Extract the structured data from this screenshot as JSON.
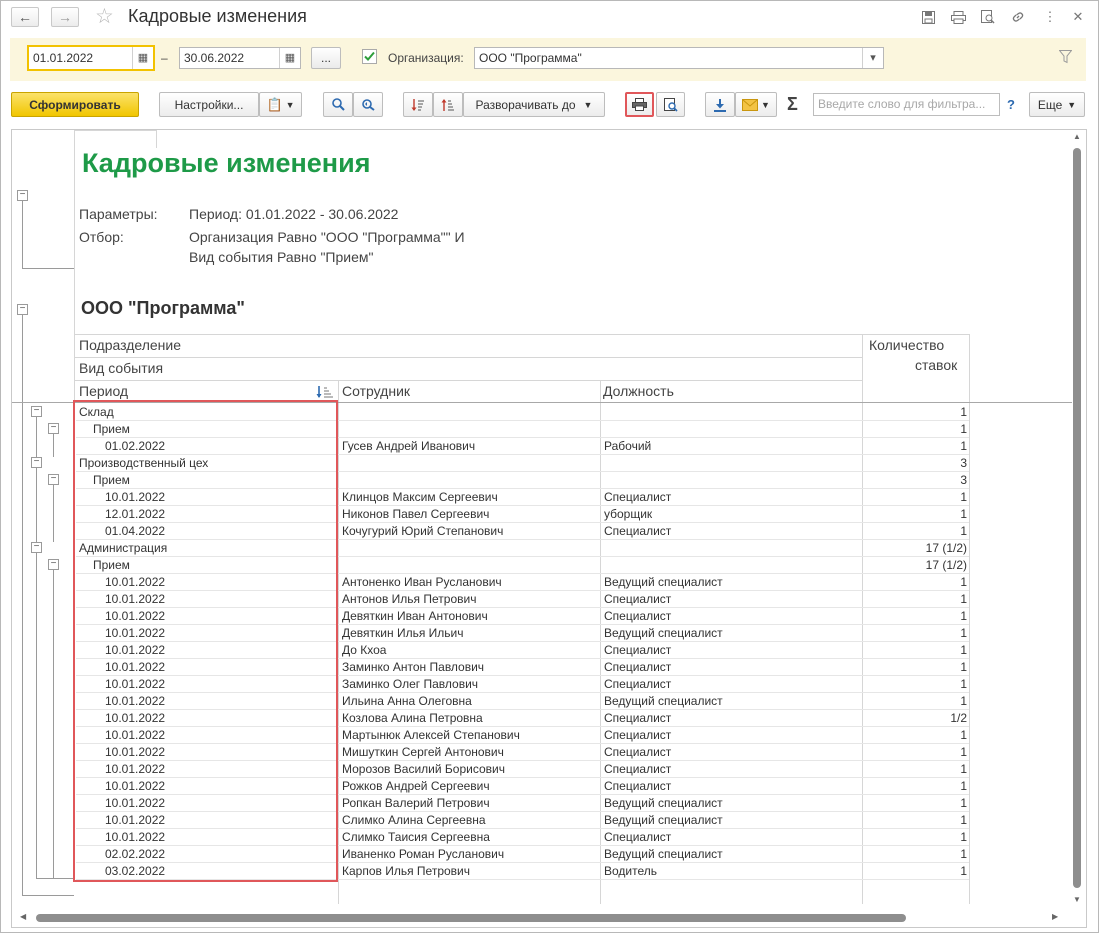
{
  "window": {
    "title": "Кадровые изменения"
  },
  "filters": {
    "date_from": "01.01.2022",
    "date_sep": "–",
    "date_to": "30.06.2022",
    "more_btn": "...",
    "org_label": "Организация:",
    "org_value": "ООО \"Программа\"",
    "org_checked": true
  },
  "toolbar": {
    "generate": "Сформировать",
    "settings": "Настройки...",
    "expand_to": "Разворачивать до",
    "sigma": "Σ",
    "search_placeholder": "Введите слово для фильтра...",
    "help": "?",
    "more": "Еще"
  },
  "report": {
    "title": "Кадровые изменения",
    "params_label": "Параметры:",
    "params_value": "Период: 01.01.2022 - 30.06.2022",
    "filter_label": "Отбор:",
    "filter_line1": "Организация Равно \"ООО \"Программа\"\" И",
    "filter_line2": "Вид события Равно \"Прием\"",
    "org_heading": "ООО \"Программа\"",
    "headers": {
      "division": "Подразделение",
      "event_type": "Вид события",
      "period": "Период",
      "employee": "Сотрудник",
      "position": "Должность",
      "rate_line1": "Количество",
      "rate_line2": "ставок"
    },
    "rows": [
      {
        "level": 0,
        "c1": "Склад",
        "c2": "",
        "c3": "",
        "c4": "1"
      },
      {
        "level": 1,
        "c1": "Прием",
        "c2": "",
        "c3": "",
        "c4": "1"
      },
      {
        "level": 2,
        "c1": "01.02.2022",
        "c2": "Гусев Андрей Иванович",
        "c3": "Рабочий",
        "c4": "1"
      },
      {
        "level": 0,
        "c1": "Производственный цех",
        "c2": "",
        "c3": "",
        "c4": "3"
      },
      {
        "level": 1,
        "c1": "Прием",
        "c2": "",
        "c3": "",
        "c4": "3"
      },
      {
        "level": 2,
        "c1": "10.01.2022",
        "c2": "Клинцов Максим Сергеевич",
        "c3": "Специалист",
        "c4": "1"
      },
      {
        "level": 2,
        "c1": "12.01.2022",
        "c2": "Никонов Павел Сергеевич",
        "c3": "уборщик",
        "c4": "1"
      },
      {
        "level": 2,
        "c1": "01.04.2022",
        "c2": "Кочугурий Юрий Степанович",
        "c3": "Специалист",
        "c4": "1"
      },
      {
        "level": 0,
        "c1": "Администрация",
        "c2": "",
        "c3": "",
        "c4": "17 (1/2)"
      },
      {
        "level": 1,
        "c1": "Прием",
        "c2": "",
        "c3": "",
        "c4": "17 (1/2)"
      },
      {
        "level": 2,
        "c1": "10.01.2022",
        "c2": "Антоненко Иван Русланович",
        "c3": "Ведущий специалист",
        "c4": "1"
      },
      {
        "level": 2,
        "c1": "10.01.2022",
        "c2": "Антонов Илья Петрович",
        "c3": "Специалист",
        "c4": "1"
      },
      {
        "level": 2,
        "c1": "10.01.2022",
        "c2": "Девяткин Иван Антонович",
        "c3": "Специалист",
        "c4": "1"
      },
      {
        "level": 2,
        "c1": "10.01.2022",
        "c2": "Девяткин Илья Ильич",
        "c3": "Ведущий специалист",
        "c4": "1"
      },
      {
        "level": 2,
        "c1": "10.01.2022",
        "c2": "До Кхоа",
        "c3": "Специалист",
        "c4": "1"
      },
      {
        "level": 2,
        "c1": "10.01.2022",
        "c2": "Заминко Антон Павлович",
        "c3": "Специалист",
        "c4": "1"
      },
      {
        "level": 2,
        "c1": "10.01.2022",
        "c2": "Заминко Олег Павлович",
        "c3": "Специалист",
        "c4": "1"
      },
      {
        "level": 2,
        "c1": "10.01.2022",
        "c2": "Ильина Анна Олеговна",
        "c3": "Ведущий специалист",
        "c4": "1"
      },
      {
        "level": 2,
        "c1": "10.01.2022",
        "c2": "Козлова Алина Петровна",
        "c3": "Специалист",
        "c4": "1/2"
      },
      {
        "level": 2,
        "c1": "10.01.2022",
        "c2": "Мартынюк Алексей Степанович",
        "c3": "Специалист",
        "c4": "1"
      },
      {
        "level": 2,
        "c1": "10.01.2022",
        "c2": "Мишуткин Сергей Антонович",
        "c3": "Специалист",
        "c4": "1"
      },
      {
        "level": 2,
        "c1": "10.01.2022",
        "c2": "Морозов Василий Борисович",
        "c3": "Специалист",
        "c4": "1"
      },
      {
        "level": 2,
        "c1": "10.01.2022",
        "c2": "Рожков Андрей Сергеевич",
        "c3": "Специалист",
        "c4": "1"
      },
      {
        "level": 2,
        "c1": "10.01.2022",
        "c2": "Ропкан Валерий Петрович",
        "c3": "Ведущий специалист",
        "c4": "1"
      },
      {
        "level": 2,
        "c1": "10.01.2022",
        "c2": "Слимко Алина Сергеевна",
        "c3": "Ведущий специалист",
        "c4": "1"
      },
      {
        "level": 2,
        "c1": "10.01.2022",
        "c2": "Слимко Таисия Сергеевна",
        "c3": "Специалист",
        "c4": "1"
      },
      {
        "level": 2,
        "c1": "02.02.2022",
        "c2": "Иваненко Роман Русланович",
        "c3": "Ведущий специалист",
        "c4": "1"
      },
      {
        "level": 2,
        "c1": "03.02.2022",
        "c2": "Карпов Илья Петрович",
        "c3": "Водитель",
        "c4": "1"
      }
    ]
  },
  "colors": {
    "title_green": "#1e9a48",
    "primary_yellow": "#f1c600",
    "filter_bg": "#fbf6dd",
    "highlight_red": "#e0575a"
  }
}
